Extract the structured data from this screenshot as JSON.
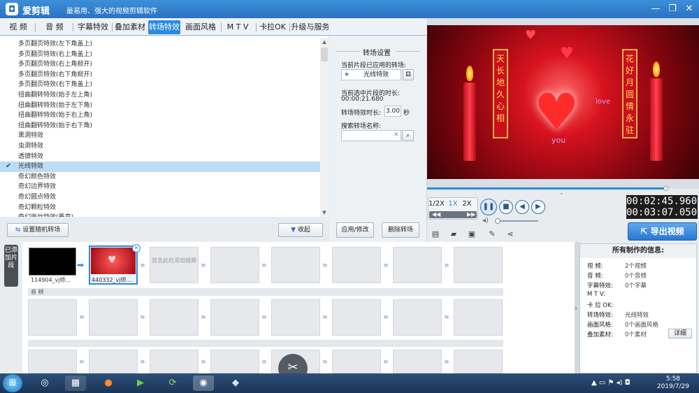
{
  "app": {
    "logo": "◘",
    "title": "爱剪辑",
    "slogan": "最易用、强大的视频剪辑软件"
  },
  "window_buttons": [
    "—",
    "❐",
    "✕"
  ],
  "tabs": [
    {
      "label": "视 频"
    },
    {
      "label": "音 频"
    },
    {
      "label": "字幕特效"
    },
    {
      "label": "叠加素材"
    },
    {
      "label": "转场特效",
      "active": true
    },
    {
      "label": "画面风格"
    },
    {
      "label": "M T V"
    },
    {
      "label": "卡拉OK"
    },
    {
      "label": "升级与服务"
    }
  ],
  "transitions": [
    "多页翻页特效(左下角盖上)",
    "多页翻页特效(右上角盖上)",
    "多页翻页特效(右上角掀开)",
    "多页翻页特效(右下角掀开)",
    "多页翻页特效(右下角盖上)",
    "扭曲翻转特效(始于左上角)",
    "扭曲翻转特效(始于左下角)",
    "扭曲翻转特效(始于右上角)",
    "扭曲翻转特效(始于右下角)",
    "黑洞特效",
    "虫洞特效",
    "透镜特效",
    "光线特效",
    "奇幻颜色特效",
    "奇幻边界特效",
    "奇幻圆点特效",
    "奇幻颗粒特效",
    "奇幻雨丝特效(垂直)"
  ],
  "selected_transition_index": 12,
  "list_buttons": {
    "random": "设置随机转场",
    "collapse": "收起"
  },
  "settings": {
    "header": "转场设置",
    "applied_label": "当前片段已应用的转场:",
    "applied_value": "光线特效",
    "clip_duration_label": "当前选中片段的时长:",
    "clip_duration_value": "00:00:21.680",
    "effect_duration_label": "转场特效时长:",
    "effect_duration_value": "3.00",
    "effect_duration_unit": "秒",
    "search_label": "搜索转场名称:",
    "search_value": "",
    "apply_button": "应用/修改",
    "delete_button": "删除转场"
  },
  "preview": {
    "love_text": "love",
    "you_text": "you",
    "banner_left": "天长地久心相",
    "banner_right": "花好月圆情永驻"
  },
  "player": {
    "speeds": [
      "1/2X",
      "1X",
      "2X"
    ],
    "current_time": "00:02:45.960",
    "total_time": "00:03:07.050",
    "progress_fraction": 0.88,
    "export_label": "导出视频"
  },
  "storyboard": {
    "label": "已添加片段",
    "clips": [
      {
        "name": "114904_vj师..."
      },
      {
        "name": "440332_vj师..."
      }
    ],
    "add_hint": "双击此处添加视频",
    "audio_label": "音 频"
  },
  "info": {
    "header": "所有制作的信息:",
    "rows": [
      {
        "k": "视    频:",
        "v": "2个视频"
      },
      {
        "k": "音    频:",
        "v": "0个音频"
      },
      {
        "k": "字幕特效:",
        "v": "0个字幕"
      },
      {
        "k": "M  T  V:",
        "v": ""
      },
      {
        "k": "卡 拉 OK:",
        "v": ""
      },
      {
        "k": "转场特效:",
        "v": "光线特效"
      },
      {
        "k": "画面风格:",
        "v": "0个画面风格"
      },
      {
        "k": "叠加素材:",
        "v": "0个素材"
      }
    ],
    "detail_button": "详细"
  },
  "taskbar": {
    "time": "5:58",
    "date": "2019/7/29"
  }
}
